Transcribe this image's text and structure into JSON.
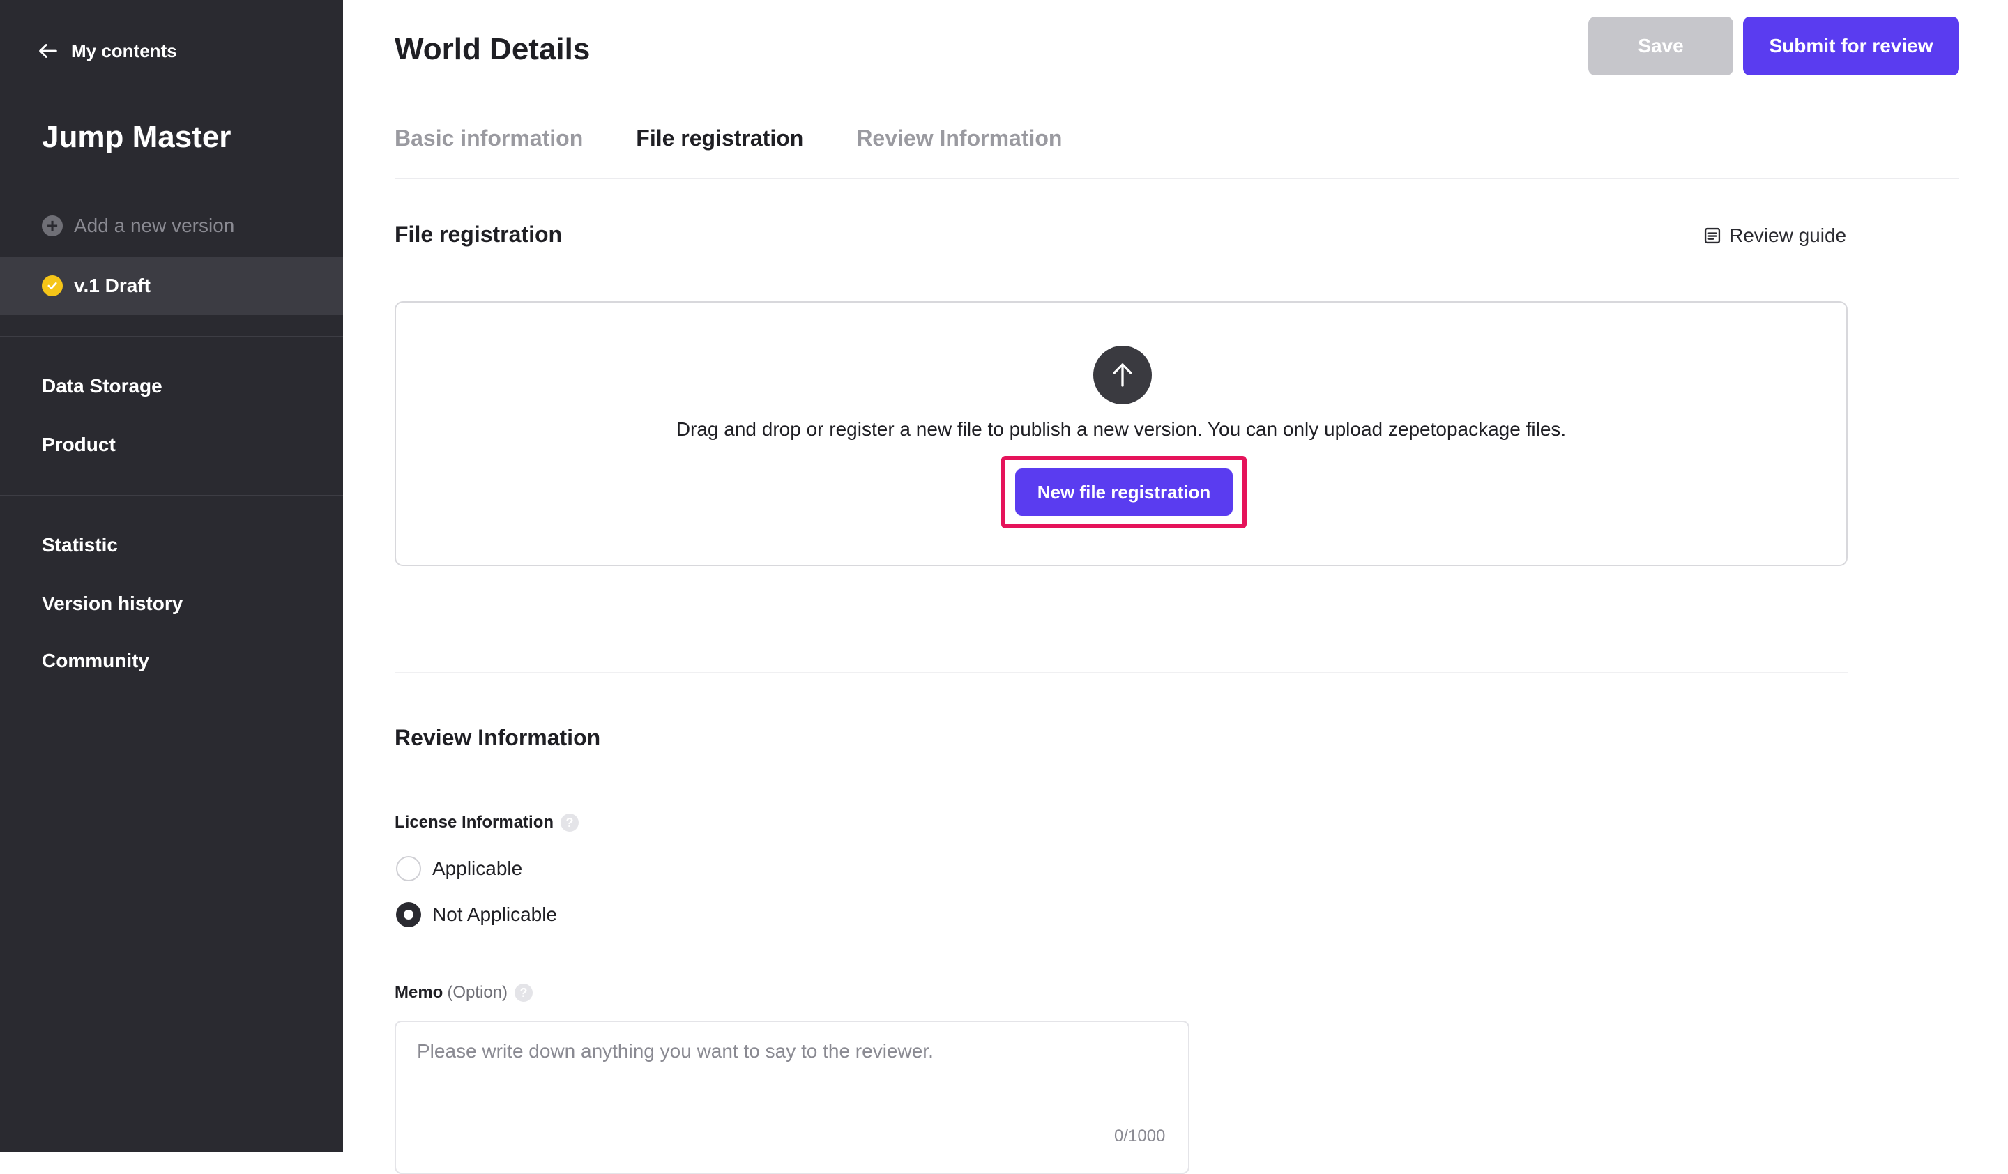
{
  "sidebar": {
    "back_label": "My contents",
    "project_title": "Jump Master",
    "add_version_label": "Add a new version",
    "active_version_label": "v.1 Draft",
    "nav_group_1": [
      "Data Storage",
      "Product"
    ],
    "nav_group_2": [
      "Statistic",
      "Version history",
      "Community"
    ]
  },
  "header": {
    "title": "World Details",
    "save_label": "Save",
    "submit_label": "Submit for review"
  },
  "tabs": [
    {
      "label": "Basic information",
      "active": false
    },
    {
      "label": "File registration",
      "active": true
    },
    {
      "label": "Review Information",
      "active": false
    }
  ],
  "file_registration": {
    "title": "File registration",
    "review_guide_label": "Review guide",
    "drop_text": "Drag and drop or register a new file to publish a new version. You can only upload zepetopackage files.",
    "new_file_button_label": "New file registration"
  },
  "review_information": {
    "title": "Review Information",
    "license_label": "License Information",
    "license_options": [
      {
        "label": "Applicable",
        "selected": false
      },
      {
        "label": "Not Applicable",
        "selected": true
      }
    ],
    "memo_label": "Memo",
    "memo_option_label": "(Option)",
    "memo_placeholder": "Please write down anything you want to say to the reviewer.",
    "memo_value": "",
    "memo_count": "0/1000"
  },
  "colors": {
    "sidebar_bg": "#2a2a30",
    "accent": "#5a3cf0",
    "highlight": "#e5135a",
    "draft_badge": "#f5c518"
  }
}
